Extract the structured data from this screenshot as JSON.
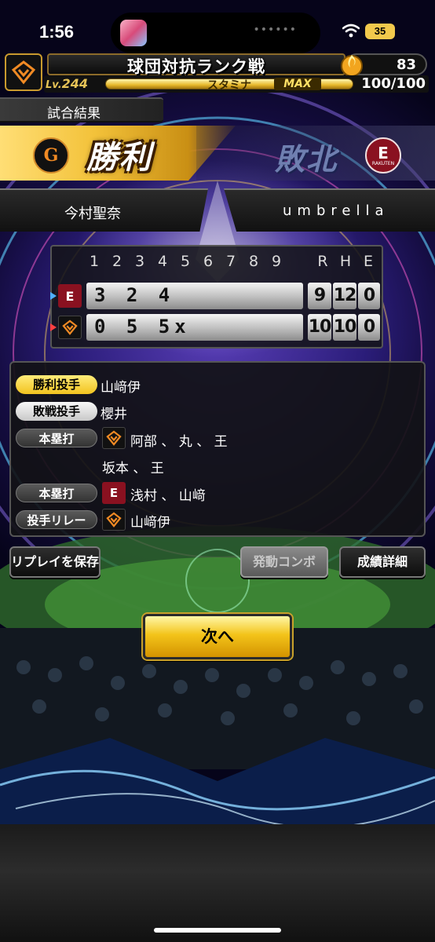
{
  "status_bar": {
    "time": "1:56",
    "battery": "35"
  },
  "header": {
    "title": "球団対抗ランク戦",
    "coins": "83",
    "level_label": "Lv.",
    "level": "244",
    "stamina_label": "スタミナ",
    "stamina_max": "MAX",
    "stamina_value": "100/100"
  },
  "result": {
    "section_label": "試合結果",
    "win_label": "勝利",
    "lose_label": "敗北",
    "player_left": "今村聖奈",
    "player_right": "umbrella"
  },
  "scoreboard": {
    "innings": [
      "1",
      "2",
      "3",
      "4",
      "5",
      "6",
      "7",
      "8",
      "9"
    ],
    "rhe_headers": [
      "R",
      "H",
      "E"
    ],
    "rows": [
      {
        "team": "eagles",
        "scores": "3 2 4",
        "R": "9",
        "H": "12",
        "E": "0"
      },
      {
        "team": "giants",
        "scores": "0 5 5x",
        "R": "10",
        "H": "10",
        "E": "0"
      }
    ]
  },
  "details": {
    "win_pitcher_label": "勝利投手",
    "win_pitcher": "山﨑伊",
    "lose_pitcher_label": "敗戦投手",
    "lose_pitcher": "櫻井",
    "hr_label_1": "本塁打",
    "hr_giants_line1": "阿部 、 丸 、 王",
    "hr_giants_line2": "坂本 、 王",
    "hr_label_2": "本塁打",
    "hr_eagles": "浅村 、 山﨑",
    "relay_label": "投手リレー",
    "relay": "山﨑伊"
  },
  "buttons": {
    "save_replay": "リプレイを保存",
    "combo": "発動コンボ",
    "stats": "成績詳細",
    "next": "次へ"
  },
  "colors": {
    "gold": "#f2c31f",
    "eagles": "#8a1120",
    "giants_orange": "#f08a24"
  }
}
